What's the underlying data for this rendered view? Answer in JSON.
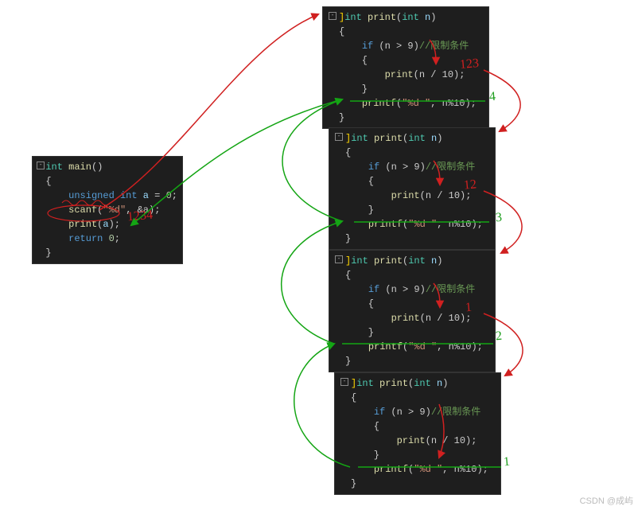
{
  "watermark": "CSDN @成屿",
  "main_box": {
    "sig_type": "int",
    "sig_name": "main",
    "sig_params": "()",
    "line_decl_kw": "unsigned int",
    "line_decl_var": "a",
    "line_decl_eq": " = ",
    "line_decl_val": "0",
    "scanf_fn": "scanf",
    "scanf_arg1": "\"%d\"",
    "scanf_arg2": ", &a",
    "print_call_fn": "print",
    "print_call_arg": "a",
    "return_kw": "return",
    "return_val": "0",
    "hand_label": "1234"
  },
  "print_boxes": [
    {
      "sig_type": "int",
      "sig_name": "print",
      "sig_param_t": "int",
      "sig_param_n": "n",
      "if_kw": "if",
      "if_cond": "(n > 9)",
      "if_cmt": "//限制条件",
      "recurse_fn": "print",
      "recurse_arg": "(n / 10)",
      "printf_fn": "printf",
      "printf_fmt": "\"%d \"",
      "printf_arg": ", n%10",
      "hand_red": "123",
      "hand_green": "4"
    },
    {
      "sig_type": "int",
      "sig_name": "print",
      "sig_param_t": "int",
      "sig_param_n": "n",
      "if_kw": "if",
      "if_cond": "(n > 9)",
      "if_cmt": "//限制条件",
      "recurse_fn": "print",
      "recurse_arg": "(n / 10)",
      "printf_fn": "printf",
      "printf_fmt": "\"%d \"",
      "printf_arg": ", n%10",
      "hand_red": "12",
      "hand_green": "3"
    },
    {
      "sig_type": "int",
      "sig_name": "print",
      "sig_param_t": "int",
      "sig_param_n": "n",
      "if_kw": "if",
      "if_cond": "(n > 9)",
      "if_cmt": "//限制条件",
      "recurse_fn": "print",
      "recurse_arg": "(n / 10)",
      "printf_fn": "printf",
      "printf_fmt": "\"%d \"",
      "printf_arg": ", n%10",
      "hand_red": "1",
      "hand_green": "2"
    },
    {
      "sig_type": "int",
      "sig_name": "print",
      "sig_param_t": "int",
      "sig_param_n": "n",
      "if_kw": "if",
      "if_cond": "(n > 9)",
      "if_cmt": "//限制条件",
      "recurse_fn": "print",
      "recurse_arg": "(n / 10)",
      "printf_fn": "printf",
      "printf_fmt": "\"%d \"",
      "printf_arg": ", n%10",
      "hand_red": "",
      "hand_green": "1"
    }
  ],
  "arrows": {
    "red": "#d02020",
    "green": "#14a514"
  }
}
